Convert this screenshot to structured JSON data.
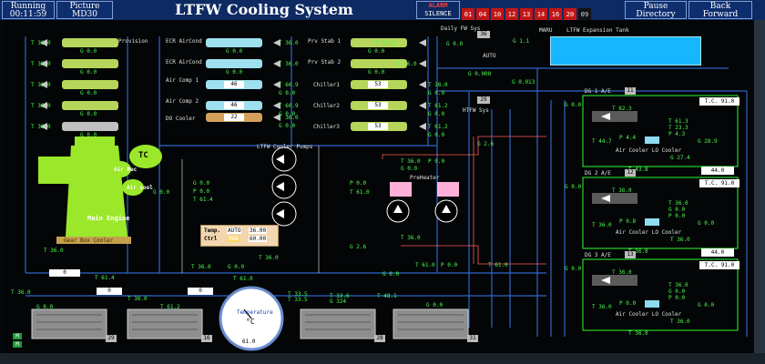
{
  "header": {
    "running_label": "Running",
    "running_time": "00:11:59",
    "picture_label": "Picture",
    "picture_id": "MD30",
    "title": "LTFW Cooling System",
    "alarm_label": "ALARM",
    "silence_label": "SILENCE",
    "alarm_codes": [
      "01",
      "04",
      "10",
      "12",
      "13",
      "14",
      "16",
      "20",
      "09"
    ],
    "pause_l1": "Pause",
    "pause_l2": "Directory",
    "back_l1": "Back",
    "back_l2": "Forward"
  },
  "colors": {
    "pipe": "#2f66c9",
    "flow_green": "#4cff4c",
    "title_bar": "#0d2a63",
    "alarm_red": "#c01616",
    "expansion_tank": "#16b7ff",
    "engine": "#9be82a"
  },
  "left_coolers": {
    "title": "Provision",
    "temps": [
      "T 38.0",
      "T 38.0",
      "T 38.0",
      "T 38.0",
      "T 38.0"
    ],
    "flows": [
      "G 0.0",
      "G 0.0",
      "G 0.0",
      "G 0.0",
      "G 0.0"
    ]
  },
  "mid_coolers": {
    "labels": [
      "ECR AirCond",
      "ECR AirCond",
      "Air Comp 1",
      "Air Comp 2",
      "DO Cooler"
    ],
    "temps": [
      "T 36.0",
      "T 36.0",
      "T 60.9",
      "T 60.9",
      "T 36.0"
    ],
    "flows": [
      "G 0.0",
      "G 0.0",
      "G 0.0",
      "G 0.0",
      "G 0.0"
    ],
    "badges": [
      "46",
      "46",
      "22"
    ]
  },
  "right_coolers": {
    "labels": [
      "Prv Stab 1",
      "Prv Stab 2",
      "Chiller1",
      "Chiller2",
      "Chiller3"
    ],
    "temps": [
      "T 36.0",
      "T 36.0",
      "T 36.0",
      "T 61.2",
      "T 61.2"
    ],
    "flows": [
      "G 0.0",
      "G 0.0",
      "G 0.0",
      "G 0.0",
      "G 0.0"
    ],
    "badges": [
      "53",
      "53",
      "53"
    ]
  },
  "top_misc": {
    "daily_fw": "Daily FW Sys",
    "daily_fw_val": "36",
    "maru": "MARU",
    "expansion": "LTFW Expansion Tank",
    "auto": "AUTO",
    "g_vals": [
      "G 0.0",
      "G 1.1",
      "G 0.000",
      "G 0.013"
    ],
    "htfw": "HTFW Sys",
    "htfw_num": "29"
  },
  "pumps": {
    "title": "LTFW Cooler Pumps",
    "left_vals": [
      "G 0.0",
      "P 0.0",
      "T 61.4"
    ],
    "right_vals": [
      "P 0.0",
      "T 61.0"
    ]
  },
  "engine": {
    "tc": "TC",
    "air_rec": "Air Rec",
    "air_cool": "Air cool",
    "main_engine": "Main Engine",
    "gear_box": "Gear Box Cooler",
    "g_val": "G 0.0"
  },
  "temp_ctrl": {
    "temp_label": "Temp.",
    "ctrl_label": "Ctrl",
    "mode1": "AUTO",
    "val1": "36.00",
    "mode2": "MAN",
    "val2": "60.00"
  },
  "preheater": {
    "label": "PreHeater",
    "vals": [
      "T 36.0",
      "P 0.0",
      "G 0.0",
      "G 2.6",
      "T 36.0"
    ]
  },
  "dg_units": [
    {
      "title": "DG 1 A/E",
      "num": "11",
      "tc": "T.C.",
      "tc_val": "91.0",
      "vals": [
        "T 82.3",
        "G 0.0",
        "T 44.7",
        "P 4.4",
        "G 28.9",
        "T 61.3",
        "P 4.3",
        "T 23.3",
        "G 27.4"
      ],
      "air": "Air Cooler LO Cooler",
      "bottom": "T 43.8"
    },
    {
      "title": "DG 2 A/E",
      "num": "12",
      "tc": "T.C.",
      "tc_val": "91.0",
      "vals": [
        "T 36.0",
        "G 0.0",
        "T 36.0",
        "P 0.8",
        "G 0.0",
        "T 36.0",
        "P 0.0",
        "G 0.0",
        "T 36.0"
      ],
      "air": "Air Cooler LO Cooler",
      "bottom": "T 36.0"
    },
    {
      "title": "DG 3 A/E",
      "num": "13",
      "tc": "T.C.",
      "tc_val": "91.0",
      "vals": [
        "T 36.0",
        "G 0.0",
        "T 36.0",
        "P 0.0",
        "G 0.0",
        "T 36.0",
        "P 0.0",
        "G 0.0",
        "T 36.0"
      ],
      "air": "Air Cooler LO Cooler",
      "bottom": "T 36.0"
    }
  ],
  "tc_side_vals": [
    "44.0",
    "44.0"
  ],
  "bottom": {
    "tanks": [
      {
        "num": "29"
      },
      {
        "num": "16"
      },
      {
        "num": "28"
      },
      {
        "num": "31"
      }
    ],
    "gauge_label": "Temperature",
    "gauge_scale": "°C",
    "gauge_value": "61.0",
    "labels": [
      "T 36.0",
      "T 61.4",
      "T 61.0",
      "T 36.0",
      "G 2.6",
      "T 61.0",
      "P 0.0",
      "T 36.0",
      "T 33.5",
      "T 33.5",
      "T 33.6",
      "G 324",
      "T 48.1",
      "G 0.0",
      "T 36.0",
      "G 0.0",
      "T 61.2",
      "G 0.0",
      "T 36.0",
      "G 0.0",
      "T 61.0"
    ],
    "inputs": [
      "0",
      "0",
      "0"
    ]
  },
  "status": {
    "indicator_top": "M",
    "indicator_bottom": "M"
  }
}
